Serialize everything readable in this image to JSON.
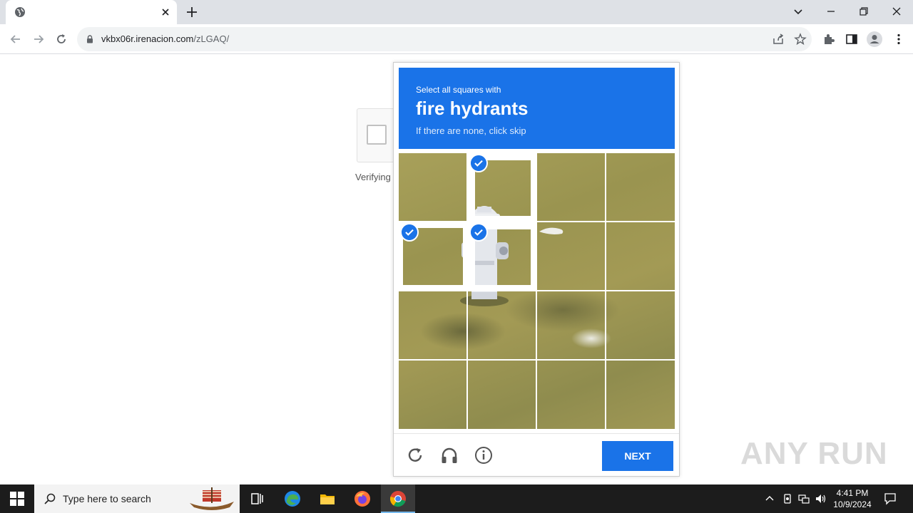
{
  "browser": {
    "tab_title": "",
    "url_host": "vkbx06r.irenacion.com",
    "url_path": "/zLGAQ/"
  },
  "page": {
    "verifying_text": "Verifying"
  },
  "captcha": {
    "prompt_small": "Select all squares with",
    "prompt_target": "fire hydrants",
    "prompt_hint": "If there are none, click skip",
    "next_label": "NEXT",
    "grid_rows": 4,
    "grid_cols": 4,
    "selected_cells": [
      "r0c1",
      "r1c0",
      "r1c1"
    ],
    "accent_color": "#1a73e8"
  },
  "watermark": {
    "text": "ANY  RUN"
  },
  "taskbar": {
    "search_placeholder": "Type here to search",
    "clock_time": "4:41 PM",
    "clock_date": "10/9/2024"
  }
}
